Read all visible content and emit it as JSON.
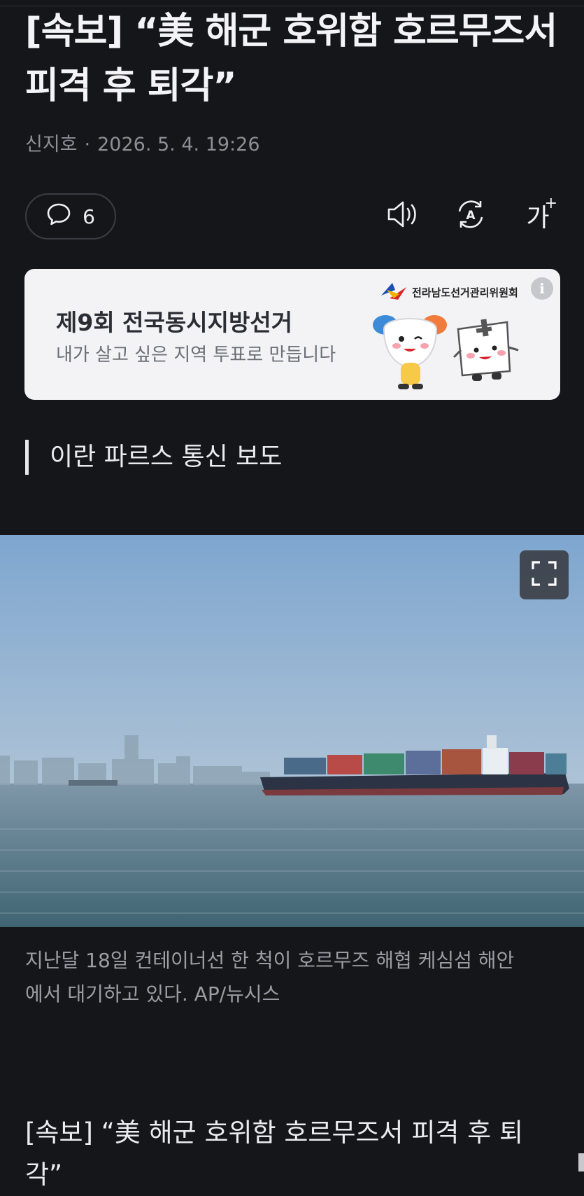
{
  "article": {
    "headline": "[속보] “美 해군 호위함 호르무즈서 피격 후 퇴각”",
    "author": "신지호",
    "date": "2026. 5. 4. 19:26",
    "comment_count": "6"
  },
  "toolbar": {
    "listen_icon": "speaker-icon",
    "translate_icon": "auto-translate-icon",
    "font_size_label": "가",
    "font_size_sup": "+"
  },
  "banner": {
    "org": "전라남도선거관리위원회",
    "title": "제9회 전국동시지방선거",
    "subtitle": "내가 살고 싶은 지역 투표로 만듭니다",
    "info_label": "i"
  },
  "subheading": "이란 파르스 통신 보도",
  "photo": {
    "caption": "지난달 18일 컨테이너선 한 척이 호르무즈 해협 케심섬 해안에서 대기하고 있다. AP/뉴시스"
  },
  "body": {
    "first_paragraph": "[속보] “美 해군 호위함 호르무즈서 피격 후 퇴각”"
  },
  "colors": {
    "background": "#151619",
    "banner_bg": "#f3f3f5",
    "muted_text": "#8c8f96"
  }
}
